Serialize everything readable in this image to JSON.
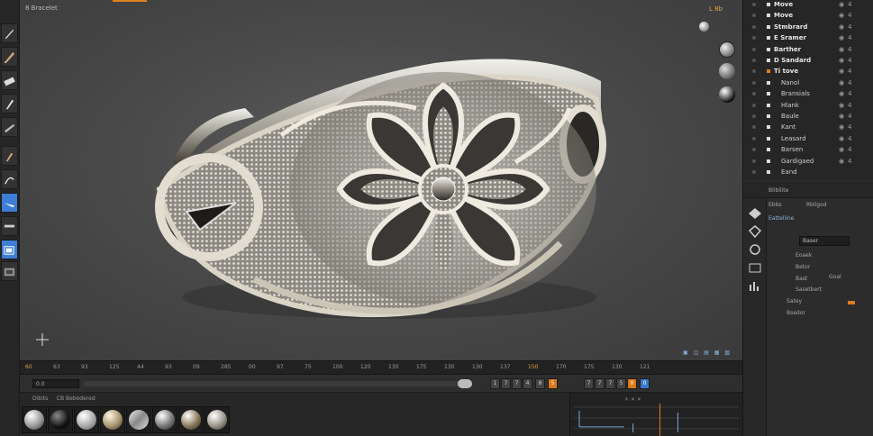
{
  "viewport": {
    "title": "8 Bracelet",
    "top_right": "L 8b"
  },
  "outliner": {
    "rows": [
      {
        "label": "Move",
        "marker": "plain",
        "eye": "◉",
        "lock": "4"
      },
      {
        "label": "Move",
        "marker": "plain",
        "eye": "◉",
        "lock": "4"
      },
      {
        "label": "Stmbrard",
        "marker": "plain",
        "eye": "◉",
        "lock": "4"
      },
      {
        "label": "E Sramer",
        "marker": "plain",
        "eye": "◉",
        "lock": "4"
      },
      {
        "label": "Barther",
        "marker": "plain",
        "eye": "◉",
        "lock": "4"
      },
      {
        "label": "D Sandard",
        "marker": "plain",
        "eye": "◉",
        "lock": "4"
      },
      {
        "label": "Ti tove",
        "marker": "orange",
        "eye": "◉",
        "lock": "4"
      },
      {
        "label": "Nanol",
        "marker": "plain",
        "eye": "◉",
        "lock": "4"
      },
      {
        "label": "Bransials",
        "marker": "plain",
        "eye": "◉",
        "lock": "4"
      },
      {
        "label": "Hlank",
        "marker": "plain",
        "eye": "◉",
        "lock": "4"
      },
      {
        "label": "Baule",
        "marker": "plain",
        "eye": "◉",
        "lock": "4"
      },
      {
        "label": "Kant",
        "marker": "plain",
        "eye": "◉",
        "lock": "4"
      },
      {
        "label": "Leasard",
        "marker": "plain",
        "eye": "◉",
        "lock": "4"
      },
      {
        "label": "Barsen",
        "marker": "plain",
        "eye": "◉",
        "lock": "4"
      },
      {
        "label": "Gardigaed",
        "marker": "plain",
        "eye": "◉",
        "lock": "4"
      },
      {
        "label": "Eand",
        "marker": "plain",
        "eye": "",
        "lock": ""
      }
    ]
  },
  "properties": {
    "header": "Blibilite",
    "tab1": "Ebbs",
    "tab2": "Rbligod",
    "section": "Eattelline",
    "field1": "Baser",
    "rows": [
      "Eoaek",
      "Betor",
      "Bast",
      "Sasetbert",
      "Satey",
      "Bsedor"
    ],
    "row_extra": "Goal"
  },
  "timeline": {
    "ticks": [
      "60",
      "63",
      "93",
      "125",
      "44",
      "93",
      "09",
      "285",
      "00",
      "97",
      "75",
      "100",
      "120",
      "130",
      "175",
      "130",
      "130",
      "137",
      "150",
      "170",
      "175",
      "130",
      "121"
    ],
    "field": "0.0",
    "buttons": [
      "1",
      "7",
      "7",
      "4",
      "8",
      "5",
      "7",
      "7",
      "7",
      "5",
      "0",
      "0"
    ]
  },
  "materials": {
    "tab1": "Dibits",
    "tab2": "CB Bebodered"
  },
  "colors": {
    "accent_orange": "#e07a20",
    "accent_blue": "#3a78cf"
  }
}
